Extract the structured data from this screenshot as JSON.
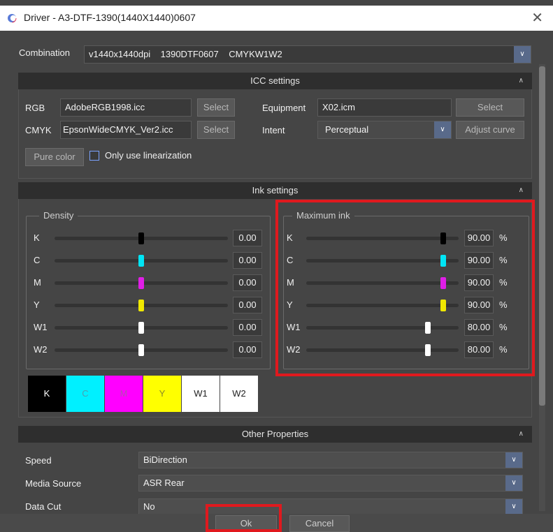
{
  "window": {
    "title": "Driver - A3-DTF-1390(1440X1440)0607"
  },
  "combination": {
    "label": "Combination",
    "value": "v1440x1440dpi    1390DTF0607    CMYKW1W2"
  },
  "icc": {
    "section_title": "ICC settings",
    "rgb_label": "RGB",
    "rgb_value": "AdobeRGB1998.icc",
    "rgb_select": "Select",
    "cmyk_label": "CMYK",
    "cmyk_value": "EpsonWideCMYK_Ver2.icc",
    "cmyk_select": "Select",
    "equipment_label": "Equipment",
    "equipment_value": "X02.icm",
    "equipment_select": "Select",
    "intent_label": "Intent",
    "intent_value": "Perceptual",
    "adjust_curve": "Adjust curve",
    "pure_color": "Pure color",
    "only_linearization": "Only use linearization"
  },
  "ink": {
    "section_title": "Ink settings",
    "density_title": "Density",
    "max_title": "Maximum ink",
    "pct_symbol": "%",
    "density": [
      {
        "label": "K",
        "value": "0.00",
        "level": 0.5,
        "color": "#000000"
      },
      {
        "label": "C",
        "value": "0.00",
        "level": 0.5,
        "color": "#00e5f5"
      },
      {
        "label": "M",
        "value": "0.00",
        "level": 0.5,
        "color": "#e01ee6"
      },
      {
        "label": "Y",
        "value": "0.00",
        "level": 0.5,
        "color": "#f0e800"
      },
      {
        "label": "W1",
        "value": "0.00",
        "level": 0.5,
        "color": "#ffffff"
      },
      {
        "label": "W2",
        "value": "0.00",
        "level": 0.5,
        "color": "#ffffff"
      }
    ],
    "maximum": [
      {
        "label": "K",
        "value": "90.00",
        "level": 0.9,
        "color": "#000000"
      },
      {
        "label": "C",
        "value": "90.00",
        "level": 0.9,
        "color": "#00e5f5"
      },
      {
        "label": "M",
        "value": "90.00",
        "level": 0.9,
        "color": "#e01ee6"
      },
      {
        "label": "Y",
        "value": "90.00",
        "level": 0.9,
        "color": "#f0e800"
      },
      {
        "label": "W1",
        "value": "80.00",
        "level": 0.8,
        "color": "#ffffff"
      },
      {
        "label": "W2",
        "value": "80.00",
        "level": 0.8,
        "color": "#ffffff"
      }
    ],
    "swatches": [
      {
        "label": "K",
        "bg": "#000000",
        "fg": "#ffffff"
      },
      {
        "label": "C",
        "bg": "#00f0ff",
        "fg": "#4aa0b0"
      },
      {
        "label": "M",
        "bg": "#ff00ff",
        "fg": "#b050b0"
      },
      {
        "label": "Y",
        "bg": "#ffff00",
        "fg": "#8a8a2a"
      },
      {
        "label": "W1",
        "bg": "#ffffff",
        "fg": "#222222"
      },
      {
        "label": "W2",
        "bg": "#ffffff",
        "fg": "#222222"
      }
    ]
  },
  "other": {
    "section_title": "Other Properties",
    "speed_label": "Speed",
    "speed_value": "BiDirection",
    "media_label": "Media Source",
    "media_value": "ASR Rear",
    "datacut_label": "Data Cut",
    "datacut_value": "No"
  },
  "footer": {
    "ok": "Ok",
    "cancel": "Cancel"
  },
  "colors": {
    "highlight": "#e0191e",
    "combo_arrow": "#596a8a"
  }
}
